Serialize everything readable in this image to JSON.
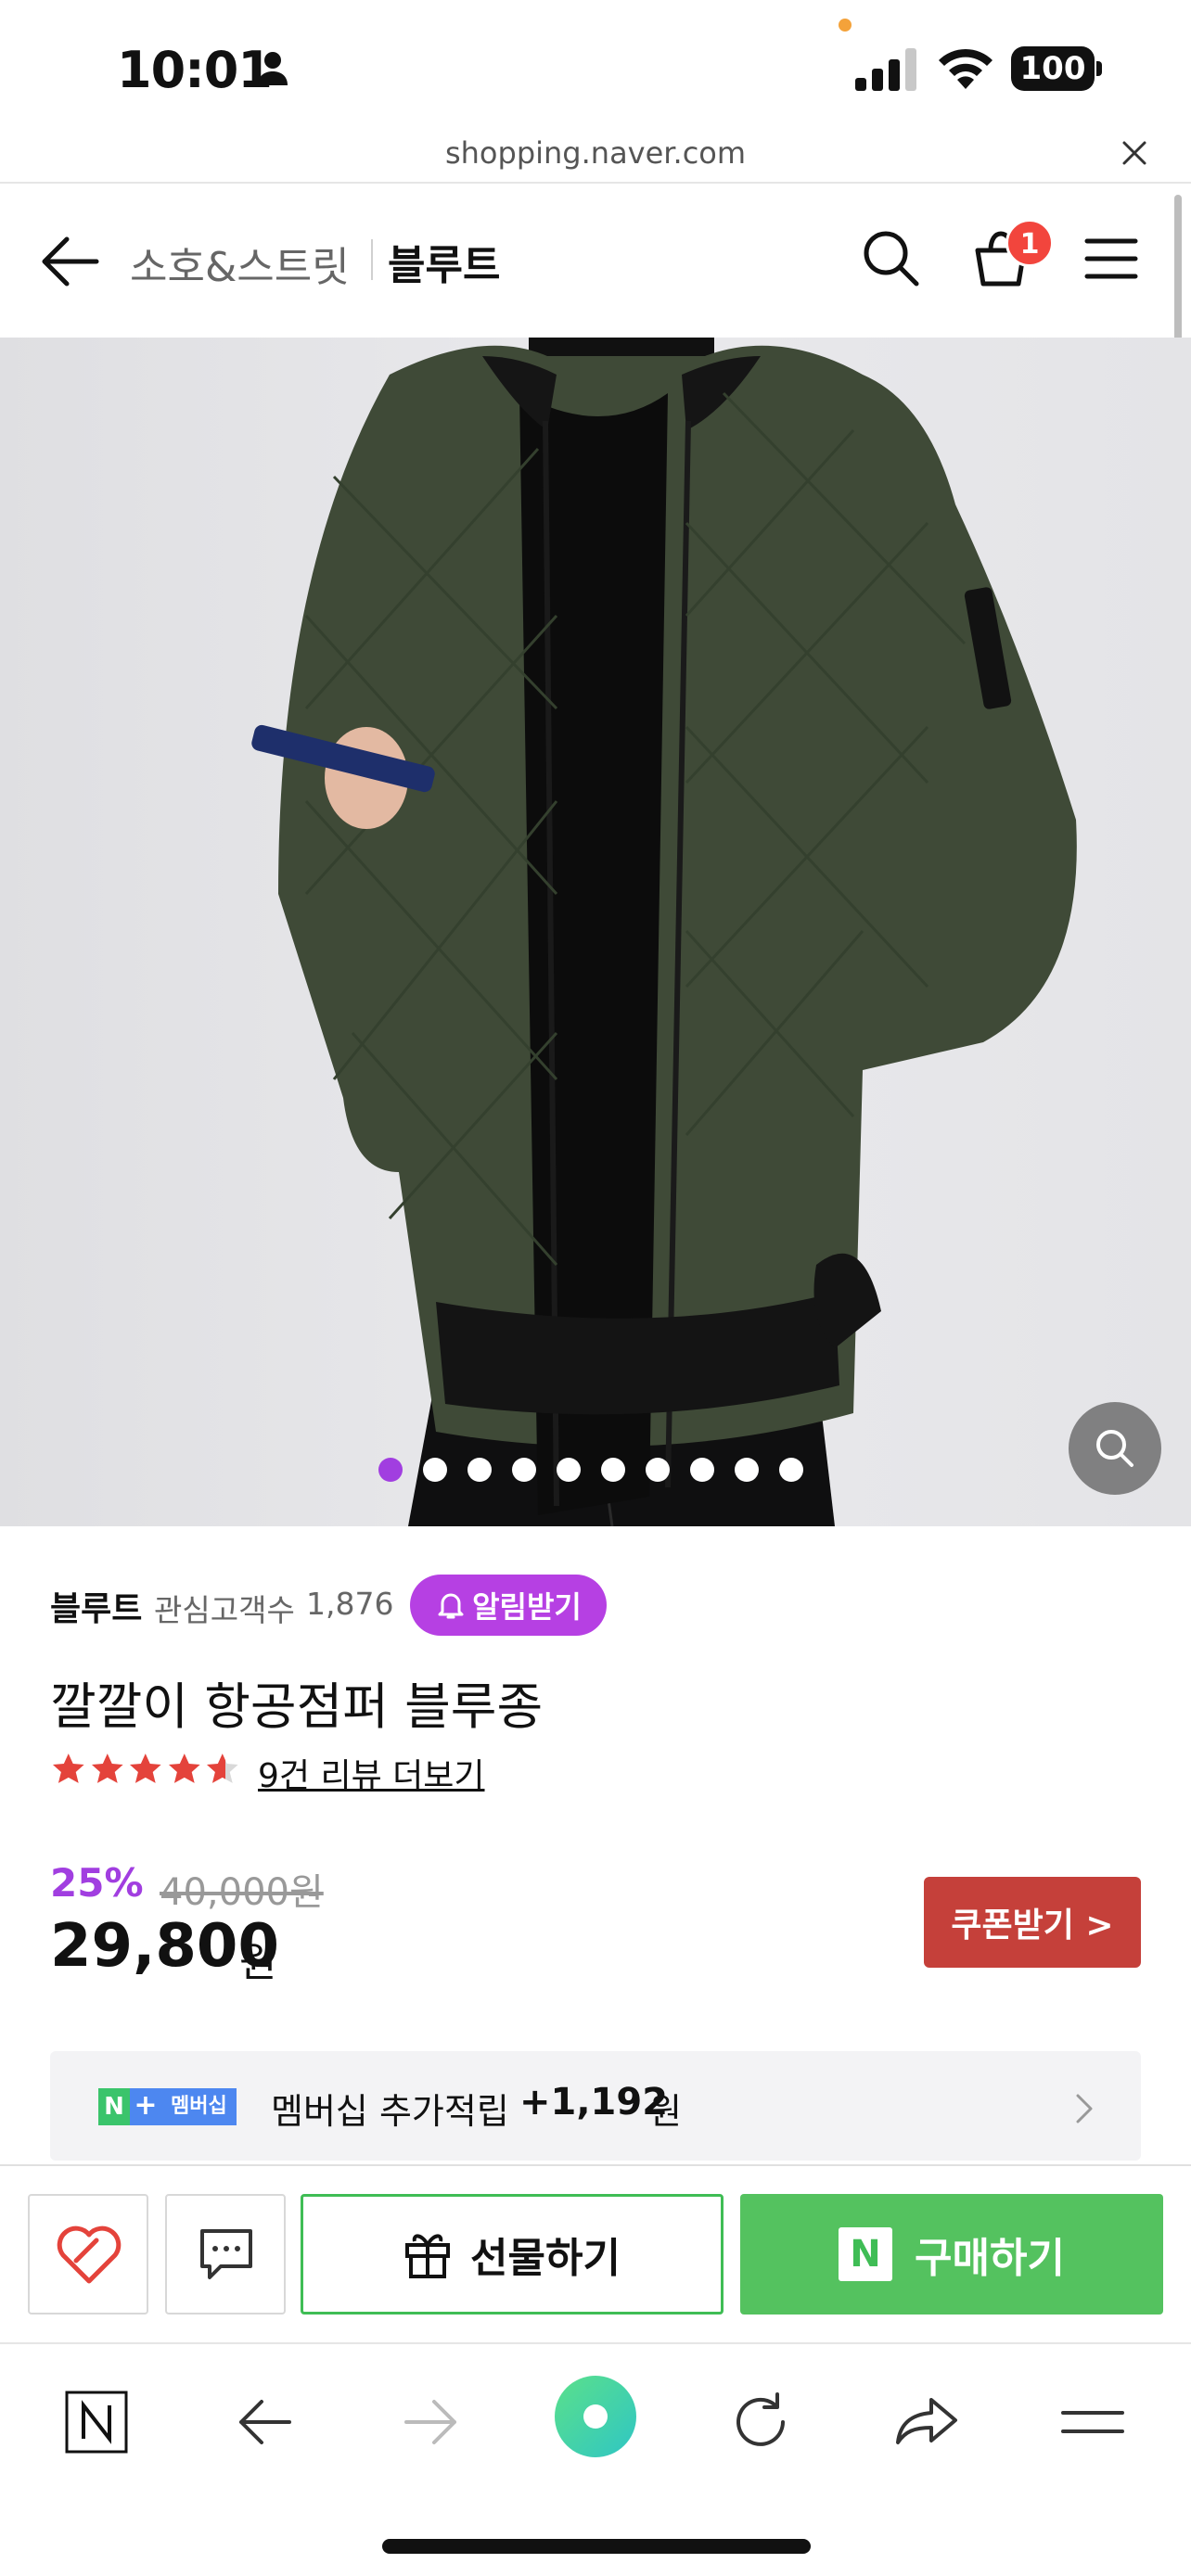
{
  "status_bar": {
    "time": "10:01",
    "battery": "100"
  },
  "url_bar": {
    "domain": "shopping.naver.com"
  },
  "top_nav": {
    "category": "소호&스트릿",
    "store": "블루트",
    "cart_count": "1"
  },
  "product": {
    "store_name": "블루트",
    "followers_label": "관심고객수",
    "followers_count": "1,876",
    "alarm_label": "알림받기",
    "title": "깔깔이 항공점퍼 블루종",
    "rating": 4.5,
    "review_link": "9건 리뷰 더보기",
    "discount": "25%",
    "original_price": "40,000원",
    "price": "29,800",
    "price_unit": "원",
    "coupon_label": "쿠폰받기 >",
    "image_index": 1,
    "image_count": 10
  },
  "membership": {
    "badge_n": "N",
    "badge_plus": "+",
    "badge_text": "멤버십",
    "label": "멤버십 추가적립",
    "amount": "+1,192",
    "unit": "원"
  },
  "actions": {
    "gift_label": "선물하기",
    "buy_label": "구매하기",
    "buy_logo": "N"
  },
  "icons": [
    "person-icon",
    "signal-icon",
    "wifi-icon",
    "close-icon",
    "back-arrow-icon",
    "search-icon",
    "cart-icon",
    "menu-icon",
    "zoom-icon",
    "bell-icon",
    "star-icon",
    "chevron-right-icon",
    "heart-icon",
    "chat-icon",
    "gift-icon",
    "naver-home-icon",
    "browser-back-icon",
    "browser-forward-icon",
    "green-dot-icon",
    "reload-icon",
    "share-icon",
    "browser-menu-icon"
  ],
  "colors": {
    "accent_purple": "#a13ee0",
    "coupon_red": "#c5403a",
    "buy_green": "#54c25f",
    "badge_red": "#f2453d"
  }
}
